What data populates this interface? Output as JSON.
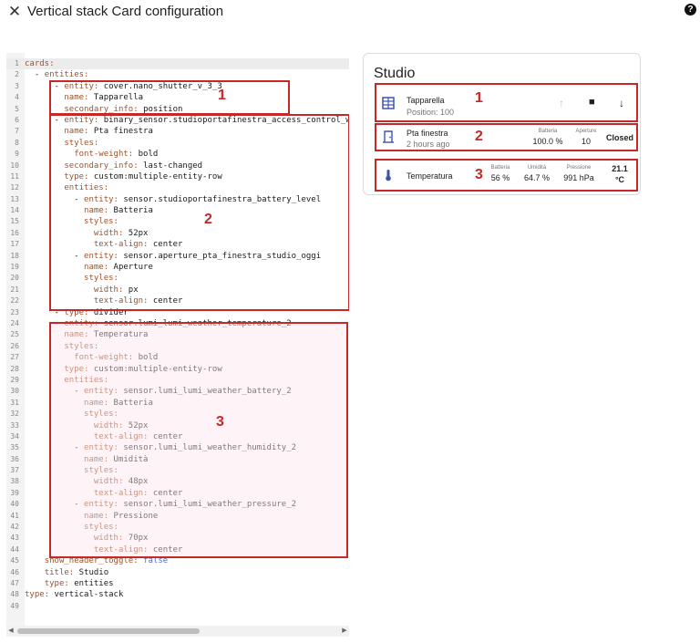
{
  "header": {
    "close_icon": "close-icon",
    "title": "Vertical stack Card configuration",
    "help_icon": "help-circle-icon",
    "help_glyph": "?"
  },
  "editor": {
    "lines": [
      [
        [
          "k",
          "cards:"
        ]
      ],
      [
        [
          "v",
          "  - "
        ],
        [
          "k",
          "entities:"
        ]
      ],
      [
        [
          "v",
          "      - "
        ],
        [
          "k",
          "entity: "
        ],
        [
          "v",
          "cover.nano_shutter_v_3_3"
        ]
      ],
      [
        [
          "v",
          "        "
        ],
        [
          "k",
          "name: "
        ],
        [
          "v",
          "Tapparella"
        ]
      ],
      [
        [
          "v",
          "        "
        ],
        [
          "k",
          "secondary_info: "
        ],
        [
          "v",
          "position"
        ]
      ],
      [
        [
          "v",
          "      - "
        ],
        [
          "k",
          "entity: "
        ],
        [
          "v",
          "binary_sensor.studioportafinestra_access_control_wind"
        ]
      ],
      [
        [
          "v",
          "        "
        ],
        [
          "k",
          "name: "
        ],
        [
          "v",
          "Pta finestra"
        ]
      ],
      [
        [
          "v",
          "        "
        ],
        [
          "k",
          "styles:"
        ]
      ],
      [
        [
          "v",
          "          "
        ],
        [
          "k",
          "font-weight: "
        ],
        [
          "v",
          "bold"
        ]
      ],
      [
        [
          "v",
          "        "
        ],
        [
          "k",
          "secondary_info: "
        ],
        [
          "v",
          "last-changed"
        ]
      ],
      [
        [
          "v",
          "        "
        ],
        [
          "k",
          "type: "
        ],
        [
          "v",
          "custom:multiple-entity-row"
        ]
      ],
      [
        [
          "v",
          "        "
        ],
        [
          "k",
          "entities:"
        ]
      ],
      [
        [
          "v",
          "          - "
        ],
        [
          "k",
          "entity: "
        ],
        [
          "v",
          "sensor.studioportafinestra_battery_level"
        ]
      ],
      [
        [
          "v",
          "            "
        ],
        [
          "k",
          "name: "
        ],
        [
          "v",
          "Batteria"
        ]
      ],
      [
        [
          "v",
          "            "
        ],
        [
          "k",
          "styles:"
        ]
      ],
      [
        [
          "v",
          "              "
        ],
        [
          "k",
          "width: "
        ],
        [
          "v",
          "52px"
        ]
      ],
      [
        [
          "v",
          "              "
        ],
        [
          "k",
          "text-align: "
        ],
        [
          "v",
          "center"
        ]
      ],
      [
        [
          "v",
          "          - "
        ],
        [
          "k",
          "entity: "
        ],
        [
          "v",
          "sensor.aperture_pta_finestra_studio_oggi"
        ]
      ],
      [
        [
          "v",
          "            "
        ],
        [
          "k",
          "name: "
        ],
        [
          "v",
          "Aperture"
        ]
      ],
      [
        [
          "v",
          "            "
        ],
        [
          "k",
          "styles:"
        ]
      ],
      [
        [
          "v",
          "              "
        ],
        [
          "k",
          "width: "
        ],
        [
          "v",
          "px"
        ]
      ],
      [
        [
          "v",
          "              "
        ],
        [
          "k",
          "text-align: "
        ],
        [
          "v",
          "center"
        ]
      ],
      [
        [
          "v",
          "      - "
        ],
        [
          "k",
          "type: "
        ],
        [
          "v",
          "divider"
        ]
      ],
      [
        [
          "v",
          "      - "
        ],
        [
          "k",
          "entity: "
        ],
        [
          "v",
          "sensor.lumi_lumi_weather_temperature_2"
        ]
      ],
      [
        [
          "v",
          "        "
        ],
        [
          "k",
          "name: "
        ],
        [
          "v",
          "Temperatura"
        ]
      ],
      [
        [
          "v",
          "        "
        ],
        [
          "k",
          "styles:"
        ]
      ],
      [
        [
          "v",
          "          "
        ],
        [
          "k",
          "font-weight: "
        ],
        [
          "v",
          "bold"
        ]
      ],
      [
        [
          "v",
          "        "
        ],
        [
          "k",
          "type: "
        ],
        [
          "v",
          "custom:multiple-entity-row"
        ]
      ],
      [
        [
          "v",
          "        "
        ],
        [
          "k",
          "entities:"
        ]
      ],
      [
        [
          "v",
          "          - "
        ],
        [
          "k",
          "entity: "
        ],
        [
          "v",
          "sensor.lumi_lumi_weather_battery_2"
        ]
      ],
      [
        [
          "v",
          "            "
        ],
        [
          "k",
          "name: "
        ],
        [
          "v",
          "Batteria"
        ]
      ],
      [
        [
          "v",
          "            "
        ],
        [
          "k",
          "styles:"
        ]
      ],
      [
        [
          "v",
          "              "
        ],
        [
          "k",
          "width: "
        ],
        [
          "v",
          "52px"
        ]
      ],
      [
        [
          "v",
          "              "
        ],
        [
          "k",
          "text-align: "
        ],
        [
          "v",
          "center"
        ]
      ],
      [
        [
          "v",
          "          - "
        ],
        [
          "k",
          "entity: "
        ],
        [
          "v",
          "sensor.lumi_lumi_weather_humidity_2"
        ]
      ],
      [
        [
          "v",
          "            "
        ],
        [
          "k",
          "name: "
        ],
        [
          "v",
          "Umidità"
        ]
      ],
      [
        [
          "v",
          "            "
        ],
        [
          "k",
          "styles:"
        ]
      ],
      [
        [
          "v",
          "              "
        ],
        [
          "k",
          "width: "
        ],
        [
          "v",
          "48px"
        ]
      ],
      [
        [
          "v",
          "              "
        ],
        [
          "k",
          "text-align: "
        ],
        [
          "v",
          "center"
        ]
      ],
      [
        [
          "v",
          "          - "
        ],
        [
          "k",
          "entity: "
        ],
        [
          "v",
          "sensor.lumi_lumi_weather_pressure_2"
        ]
      ],
      [
        [
          "v",
          "            "
        ],
        [
          "k",
          "name: "
        ],
        [
          "v",
          "Pressione"
        ]
      ],
      [
        [
          "v",
          "            "
        ],
        [
          "k",
          "styles:"
        ]
      ],
      [
        [
          "v",
          "              "
        ],
        [
          "k",
          "width: "
        ],
        [
          "v",
          "70px"
        ]
      ],
      [
        [
          "v",
          "              "
        ],
        [
          "k",
          "text-align: "
        ],
        [
          "v",
          "center"
        ]
      ],
      [
        [
          "v",
          "    "
        ],
        [
          "k",
          "show_header_toggle: "
        ],
        [
          "b",
          "false"
        ]
      ],
      [
        [
          "v",
          "    "
        ],
        [
          "k",
          "title: "
        ],
        [
          "v",
          "Studio"
        ]
      ],
      [
        [
          "v",
          "    "
        ],
        [
          "k",
          "type: "
        ],
        [
          "v",
          "entities"
        ]
      ],
      [
        [
          "k",
          "type: "
        ],
        [
          "v",
          "vertical-stack"
        ]
      ],
      [
        [
          "v",
          ""
        ]
      ]
    ],
    "annotations": [
      "1",
      "2",
      "3"
    ],
    "scroll_left_glyph": "◀",
    "scroll_right_glyph": "▶"
  },
  "card": {
    "title": "Studio",
    "rows": {
      "tapparella": {
        "icon": "window-shutter-icon",
        "name": "Tapparella",
        "secondary": "Position: 100",
        "annotation": "1",
        "up_glyph": "↑",
        "stop_glyph": "■",
        "down_glyph": "↓"
      },
      "pta": {
        "icon": "door-icon",
        "name": "Pta finestra",
        "secondary": "2 hours ago",
        "annotation": "2",
        "entities": [
          {
            "label": "Batteria",
            "value": "100.0 %"
          },
          {
            "label": "Aperture",
            "value": "10"
          }
        ],
        "state": "Closed"
      },
      "temp": {
        "icon": "thermometer-icon",
        "name": "Temperatura",
        "annotation": "3",
        "entities": [
          {
            "label": "Batteria",
            "value": "56 %"
          },
          {
            "label": "Umidità",
            "value": "64.7 %"
          },
          {
            "label": "Pressione",
            "value": "991 hPa"
          }
        ],
        "state_value": "21.1",
        "state_unit": "°C"
      }
    }
  },
  "colors": {
    "annotation": "#c62828",
    "icon": "#3f51b5",
    "key": "#a0522d",
    "bool": "#5c6bc0"
  }
}
